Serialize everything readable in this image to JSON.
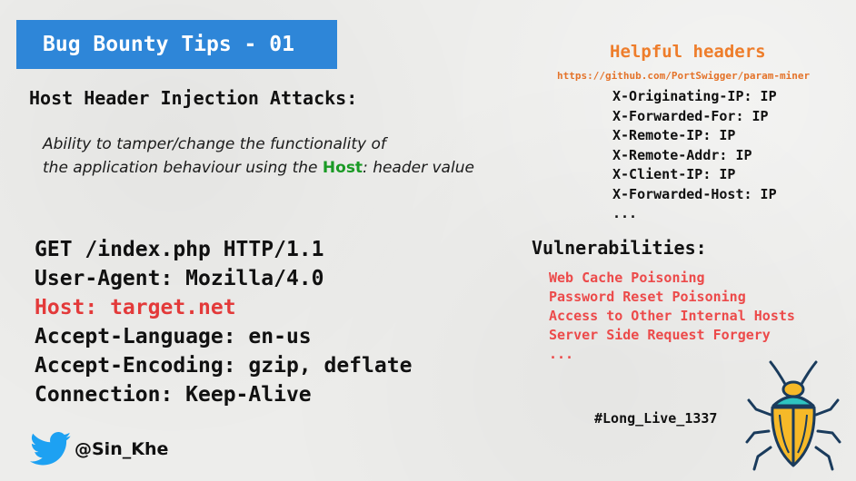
{
  "title": "Bug Bounty Tips - 01",
  "heading": "Host Header Injection Attacks:",
  "description": {
    "line1": "Ability to tamper/change the functionality of",
    "line2_before": "the application behaviour using the ",
    "line2_host": "Host",
    "line2_after": ": header value"
  },
  "request_lines": [
    "GET /index.php HTTP/1.1",
    "User-Agent: Mozilla/4.0",
    "Host: target.net",
    "Accept-Language: en-us",
    "Accept-Encoding: gzip, deflate",
    "Connection: Keep-Alive"
  ],
  "helpful_headers": {
    "title": "Helpful headers",
    "url": "https://github.com/PortSwigger/param-miner",
    "items": [
      "X-Originating-IP: IP",
      "X-Forwarded-For: IP",
      "X-Remote-IP: IP",
      "X-Remote-Addr: IP",
      "X-Client-IP: IP",
      "X-Forwarded-Host: IP",
      "..."
    ]
  },
  "vulnerabilities": {
    "title": "Vulnerabilities:",
    "items": [
      "Web Cache Poisoning",
      "Password Reset Poisoning",
      "Access to Other Internal Hosts",
      "Server Side Request Forgery",
      "..."
    ]
  },
  "hashtag": "#Long_Live_1337",
  "twitter_handle": "@Sin_Khe",
  "colors": {
    "banner": "#2e86d8",
    "accent_orange": "#ee7d2b",
    "accent_red": "#e33a3a",
    "host_green": "#1a9a25"
  },
  "icons": [
    "twitter-bird-icon",
    "bug-icon"
  ]
}
